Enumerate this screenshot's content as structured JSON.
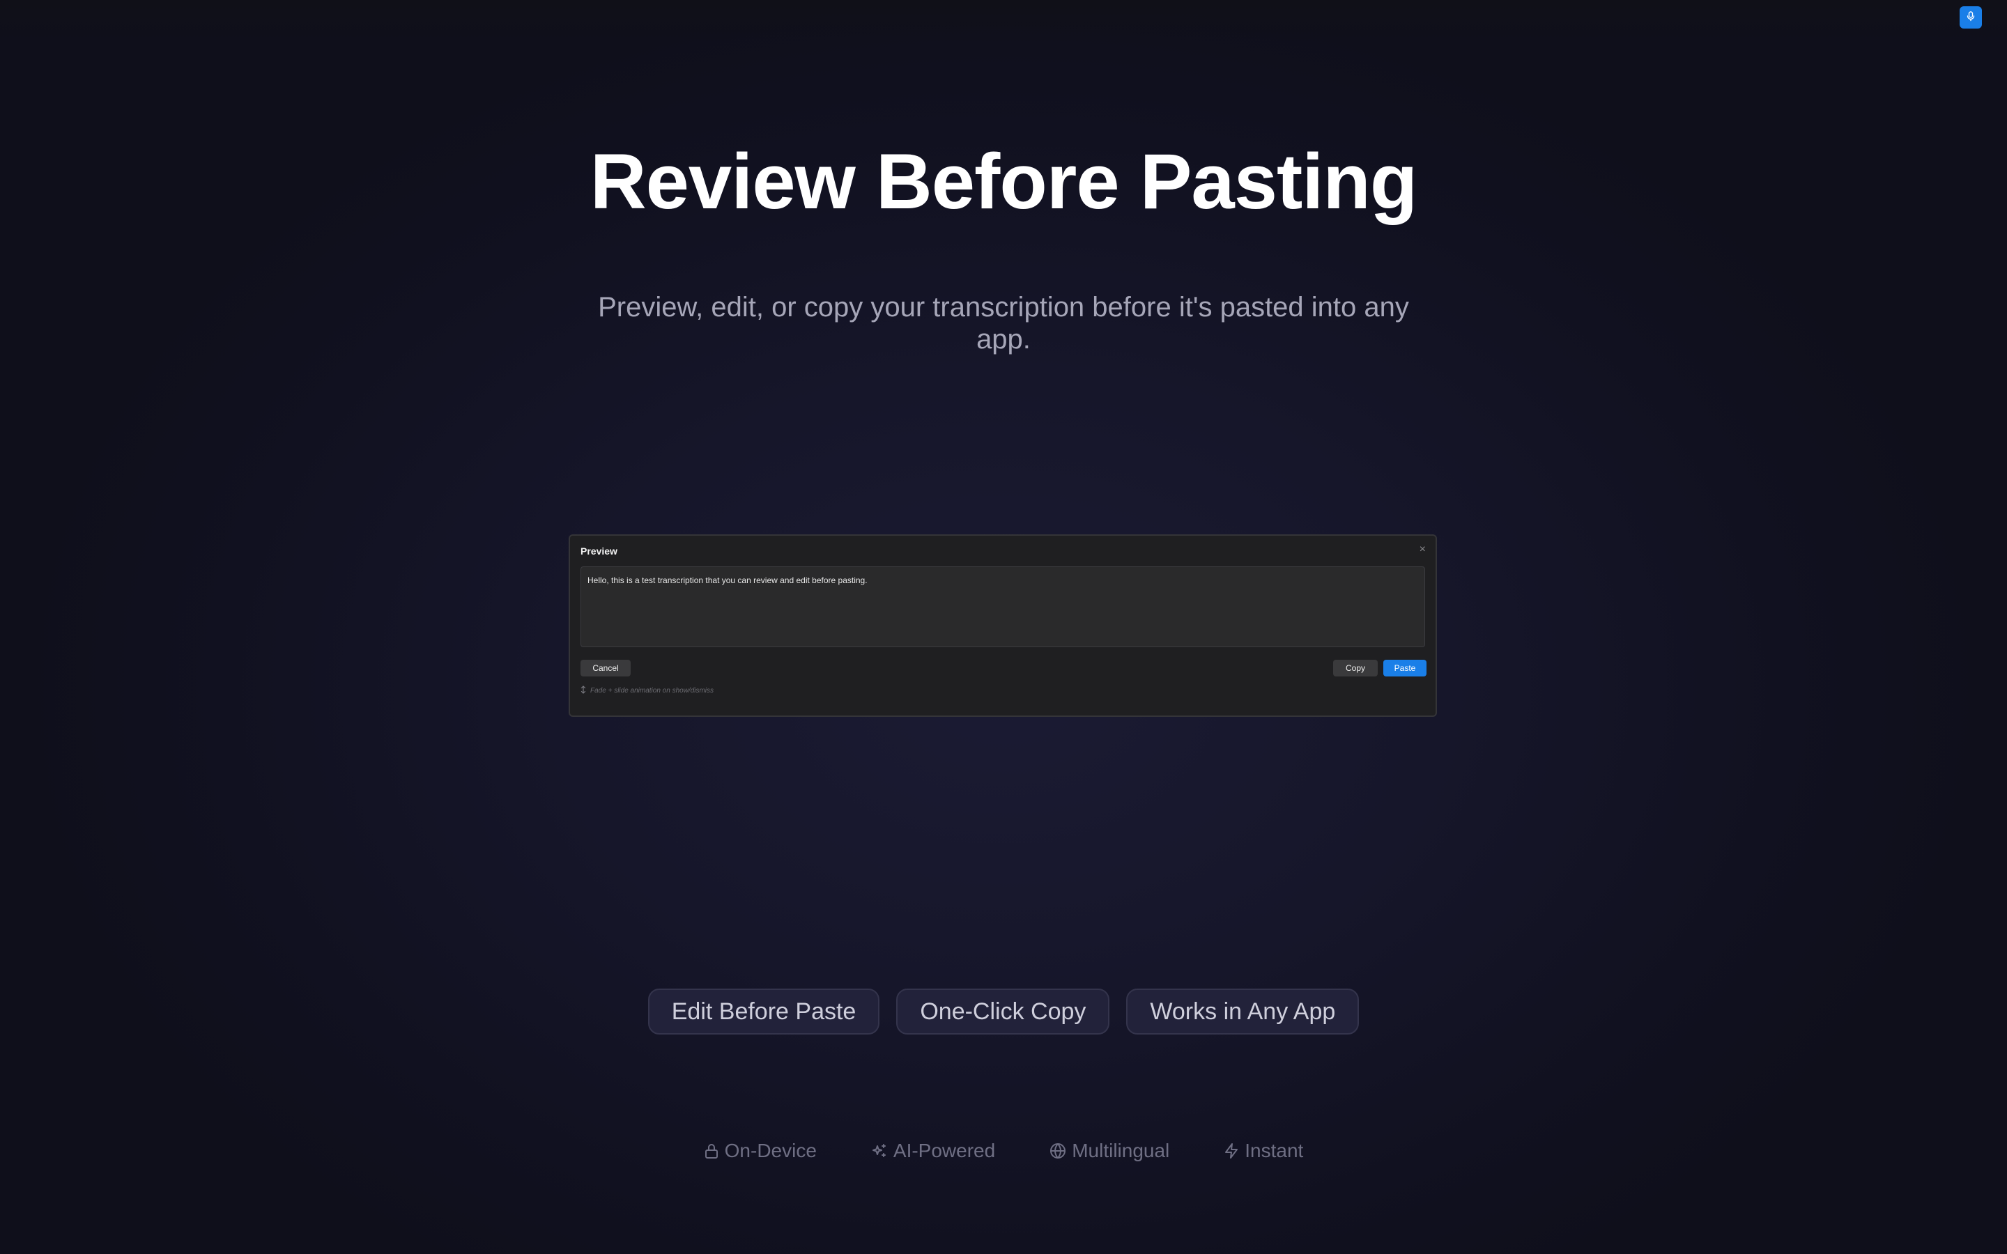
{
  "page": {
    "title": "Review Before Pasting",
    "subtitle": "Preview, edit, or copy your transcription before it's pasted into any app."
  },
  "toolbar": {
    "mic_icon": "microphone-icon",
    "accent": "#1a7fe8"
  },
  "dialog": {
    "title": "Preview",
    "close_glyph": "×",
    "text": "Hello, this is a test transcription that you can review and edit before pasting.",
    "cancel_label": "Cancel",
    "copy_label": "Copy",
    "paste_label": "Paste",
    "hint": "Fade + slide animation on show/dismiss"
  },
  "features": [
    {
      "label": "Edit Before Paste"
    },
    {
      "label": "One-Click Copy"
    },
    {
      "label": "Works in Any App"
    }
  ],
  "badges": [
    {
      "label": "On-Device",
      "icon": "lock-icon"
    },
    {
      "label": "AI-Powered",
      "icon": "sparkles-icon"
    },
    {
      "label": "Multilingual",
      "icon": "globe-icon"
    },
    {
      "label": "Instant",
      "icon": "bolt-icon"
    }
  ]
}
